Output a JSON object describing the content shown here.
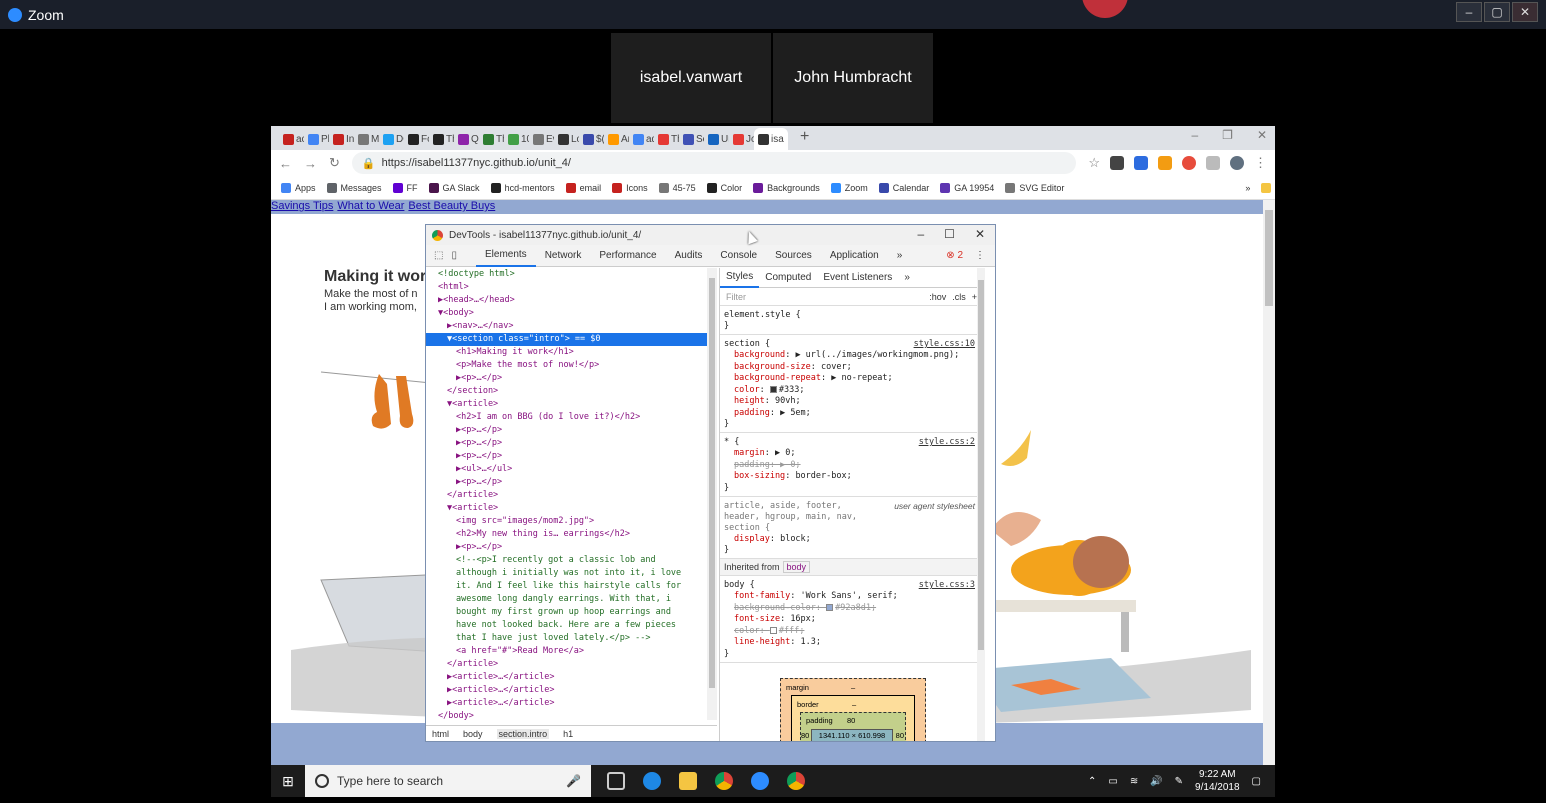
{
  "zoom": {
    "title": "Zoom",
    "participants": [
      "isabel.vanwart",
      "John Humbracht"
    ]
  },
  "browser": {
    "tabs": [
      "ac",
      "Ple",
      "Inl",
      "M",
      "DC",
      "Fo",
      "Th",
      "Qu",
      "Th",
      "10",
      "Ev",
      "Lo",
      "$(",
      "An",
      "ad",
      "Th",
      "Se",
      "Ur",
      "Jo",
      "isa"
    ],
    "url": "https://isabel11377nyc.github.io/unit_4/",
    "bookmarks": [
      "Apps",
      "Messages",
      "FF",
      "GA Slack",
      "hcd-mentors",
      "email",
      "Icons",
      "45-75",
      "Color",
      "Backgrounds",
      "Zoom",
      "Calendar",
      "GA 19954",
      "SVG Editor",
      "»",
      "Other bookmarks"
    ]
  },
  "page": {
    "nav_links": [
      "Savings Tips",
      "What to Wear",
      "Best Beauty Buys"
    ],
    "h1": "Making it wor",
    "p1": "Make the most of n",
    "p2": "I am working mom,"
  },
  "devtools": {
    "title": "DevTools - isabel11377nyc.github.io/unit_4/",
    "tabs": [
      "Elements",
      "Network",
      "Performance",
      "Audits",
      "Console",
      "Sources",
      "Application",
      "»"
    ],
    "error_count": "2",
    "breadcrumb": [
      "html",
      "body",
      "section.intro",
      "h1"
    ],
    "styles_tabs": [
      "Styles",
      "Computed",
      "Event Listeners",
      "»"
    ],
    "filter_placeholder": "Filter",
    "filter_flags": [
      ":hov",
      ".cls",
      "+"
    ],
    "inherited_label": "Inherited from",
    "inherited_tag": "body",
    "boxmodel": {
      "margin_label": "margin",
      "margin_value": "–",
      "border_label": "border",
      "border_value": "–",
      "padding_label": "padding",
      "padding_value": "80",
      "content": "1341.110 × 610.998",
      "padding_left": "80",
      "padding_right": "80",
      "margin_left": "–"
    }
  },
  "elements_tree": [
    {
      "indent": 1,
      "html": "<!doctype html>",
      "kind": "comment"
    },
    {
      "indent": 1,
      "html": "<html>"
    },
    {
      "indent": 1,
      "html": "▶<head>…</head>"
    },
    {
      "indent": 1,
      "html": "▼<body>"
    },
    {
      "indent": 2,
      "html": "▶<nav>…</nav>"
    },
    {
      "indent": 2,
      "html": "▼<section class=\"intro\"> == $0",
      "sel": true
    },
    {
      "indent": 3,
      "html": "<h1>Making it work</h1>"
    },
    {
      "indent": 3,
      "html": "<p>Make the most of now!</p>"
    },
    {
      "indent": 3,
      "html": "▶<p>…</p>"
    },
    {
      "indent": 2,
      "html": "</section>"
    },
    {
      "indent": 2,
      "html": "▼<article>"
    },
    {
      "indent": 3,
      "html": "<h2>I am on BBG (do I love it?)</h2>"
    },
    {
      "indent": 3,
      "html": "▶<p>…</p>"
    },
    {
      "indent": 3,
      "html": "▶<p>…</p>"
    },
    {
      "indent": 3,
      "html": "▶<p>…</p>"
    },
    {
      "indent": 3,
      "html": "▶<ul>…</ul>"
    },
    {
      "indent": 3,
      "html": "▶<p>…</p>"
    },
    {
      "indent": 2,
      "html": "</article>"
    },
    {
      "indent": 2,
      "html": "▼<article>"
    },
    {
      "indent": 3,
      "html": "<img src=\"images/mom2.jpg\">"
    },
    {
      "indent": 3,
      "html": "<h2>My new thing is… earrings</h2>"
    },
    {
      "indent": 3,
      "html": "▶<p>…</p>"
    },
    {
      "indent": 3,
      "html": "<!--<p>I recently got a classic lob and",
      "kind": "comment"
    },
    {
      "indent": 3,
      "html": "although i initially was not into it, i love",
      "kind": "comment"
    },
    {
      "indent": 3,
      "html": "it. And I feel like this hairstyle calls for",
      "kind": "comment"
    },
    {
      "indent": 3,
      "html": "awesome long dangly earrings. With that, i",
      "kind": "comment"
    },
    {
      "indent": 3,
      "html": "bought my first grown up hoop earrings and",
      "kind": "comment"
    },
    {
      "indent": 3,
      "html": "have not looked back. Here are a few pieces",
      "kind": "comment"
    },
    {
      "indent": 3,
      "html": "that I have just loved lately.</p> -->",
      "kind": "comment"
    },
    {
      "indent": 3,
      "html": "<a href=\"#\">Read More</a>"
    },
    {
      "indent": 2,
      "html": "</article>"
    },
    {
      "indent": 2,
      "html": "▶<article>…</article>"
    },
    {
      "indent": 2,
      "html": "▶<article>…</article>"
    },
    {
      "indent": 2,
      "html": "▶<article>…</article>"
    },
    {
      "indent": 1,
      "html": "</body>"
    },
    {
      "indent": 1,
      "html": "</html>"
    }
  ],
  "style_rules": [
    {
      "selector": "element.style {",
      "src": "",
      "props": [],
      "close": "}"
    },
    {
      "selector": "section {",
      "src": "style.css:10",
      "props": [
        {
          "name": "background",
          "value": "▶ url(../images/workingmom.png);"
        },
        {
          "name": "background-size",
          "value": "cover;"
        },
        {
          "name": "background-repeat",
          "value": "▶ no-repeat;"
        },
        {
          "name": "color",
          "value": "#333;",
          "swatch": "#333333"
        },
        {
          "name": "height",
          "value": "90vh;"
        },
        {
          "name": "padding",
          "value": "▶ 5em;"
        }
      ],
      "close": "}"
    },
    {
      "selector": "* {",
      "src": "style.css:2",
      "props": [
        {
          "name": "margin",
          "value": "▶ 0;"
        },
        {
          "name": "padding",
          "value": "▶ 0;",
          "strike": true
        },
        {
          "name": "box-sizing",
          "value": "border-box;"
        }
      ],
      "close": "}"
    },
    {
      "selector": "article, aside, footer, header, hgroup, main, nav, section {",
      "src": "",
      "ua": "user agent stylesheet",
      "props": [
        {
          "name": "display",
          "value": "block;"
        }
      ],
      "close": "}"
    }
  ],
  "body_rule": {
    "selector": "body {",
    "src": "style.css:3",
    "props": [
      {
        "name": "font-family",
        "value": "'Work Sans', serif;"
      },
      {
        "name": "background-color",
        "value": "#92a8d1;",
        "swatch": "#92a8d1",
        "strike": true
      },
      {
        "name": "font-size",
        "value": "16px;"
      },
      {
        "name": "color",
        "value": "#fff;",
        "swatch": "#ffffff",
        "strike": true
      },
      {
        "name": "line-height",
        "value": "1.3;"
      }
    ],
    "close": "}"
  },
  "taskbar": {
    "search_placeholder": "Type here to search",
    "time": "9:22 AM",
    "date": "9/14/2018"
  },
  "colors": {
    "page_nav_bg": "#92a8d1",
    "selection": "#1a73e8"
  }
}
